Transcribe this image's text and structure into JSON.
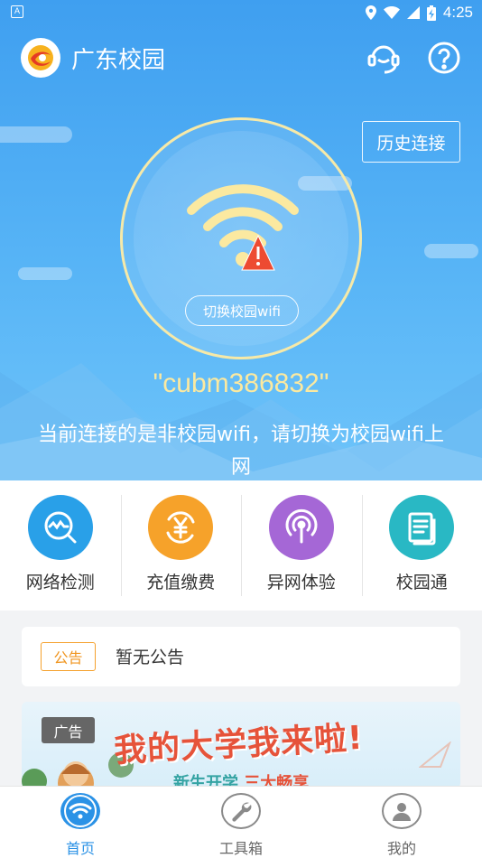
{
  "status_bar": {
    "left_icon": "A",
    "time": "4:25",
    "icons": [
      "location-icon",
      "wifi-signal-icon",
      "cell-signal-icon",
      "battery-charging-icon"
    ]
  },
  "header": {
    "title": "广东校园",
    "logo_icon": "app-logo-icon",
    "support_icon": "headset-icon",
    "help_icon": "help-circle-icon"
  },
  "hero": {
    "history_label": "历史连接",
    "switch_label": "切换校园wifi",
    "ssid": "\"cubm386832\"",
    "message": "当前连接的是非校园wifi，请切换为校园wifi上网",
    "wifi_icon": "wifi-warning-icon",
    "accent_color": "#fbe9a0"
  },
  "quick_actions": [
    {
      "label": "网络检测",
      "icon": "network-check-icon",
      "color": "#29a0e8"
    },
    {
      "label": "充值缴费",
      "icon": "recharge-yen-icon",
      "color": "#f6a22a"
    },
    {
      "label": "异网体验",
      "icon": "broadcast-icon",
      "color": "#a567d6"
    },
    {
      "label": "校园通",
      "icon": "document-icon",
      "color": "#29b8c4"
    }
  ],
  "notice": {
    "tag": "公告",
    "text": "暂无公告"
  },
  "ad": {
    "tag": "广告",
    "title": "我的大学我来啦!",
    "subtitle_prefix": "新生开学",
    "subtitle_highlight": "三大畅享"
  },
  "bottom_nav": [
    {
      "label": "首页",
      "icon": "wifi-home-icon",
      "active": true
    },
    {
      "label": "工具箱",
      "icon": "wrench-icon",
      "active": false
    },
    {
      "label": "我的",
      "icon": "user-icon",
      "active": false
    }
  ]
}
